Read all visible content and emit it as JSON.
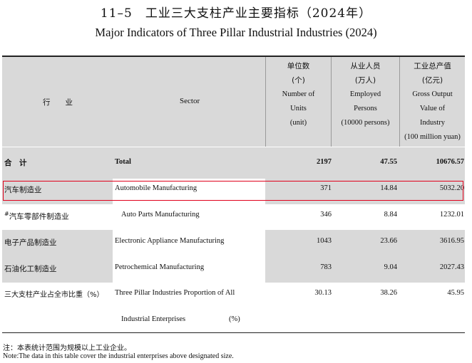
{
  "title": {
    "cn": "11–5　工业三大支柱产业主要指标（2024年）",
    "en": "Major Indicators of Three Pillar Industrial Industries (2024)"
  },
  "header": {
    "industry_cn": "行　　业",
    "sector_en": "Sector",
    "units": {
      "lines": [
        "单位数",
        "(个)",
        "Number of",
        "Units",
        "(unit)"
      ]
    },
    "employed": {
      "lines": [
        "从业人员",
        "(万人)",
        "Employed",
        "Persons",
        "(10000 persons)"
      ]
    },
    "output": {
      "lines": [
        "工业总产值",
        "(亿元)",
        "Gross Output",
        "Value of",
        "Industry",
        "(100 million yuan)"
      ]
    }
  },
  "rows": [
    {
      "cn": "合　计",
      "en": "Total",
      "units": "2197",
      "employed": "47.55",
      "output": "10676.57"
    },
    {
      "cn": "汽车制造业",
      "en": "Automobile Manufacturing",
      "units": "371",
      "employed": "14.84",
      "output": "5032.20"
    },
    {
      "cn_mark": "#",
      "cn": "汽车零部件制造业",
      "en": "Auto Parts Manufacturing",
      "units": "346",
      "employed": "8.84",
      "output": "1232.01"
    },
    {
      "cn": "电子产品制造业",
      "en": "Electronic Appliance Manufacturing",
      "units": "1043",
      "employed": "23.66",
      "output": "3616.95"
    },
    {
      "cn": "石油化工制造业",
      "en": "Petrochemical Manufacturing",
      "units": "783",
      "employed": "9.04",
      "output": "2027.43"
    },
    {
      "cn": "三大支柱产业占全市比重（%）",
      "en": "Three Pillar Industries Proportion of All",
      "en2": "Industrial Enterprises",
      "en2_unit": "(%)",
      "units": "30.13",
      "employed": "38.26",
      "output": "45.95"
    }
  ],
  "notes": {
    "cn": "注：本表统计范围为规模以上工业企业。",
    "en": "Note:The data in this table cover the industrial enterprises above designated size."
  },
  "colors": {
    "header_bg": "#d9d9d9",
    "highlight": "#e0001b"
  }
}
